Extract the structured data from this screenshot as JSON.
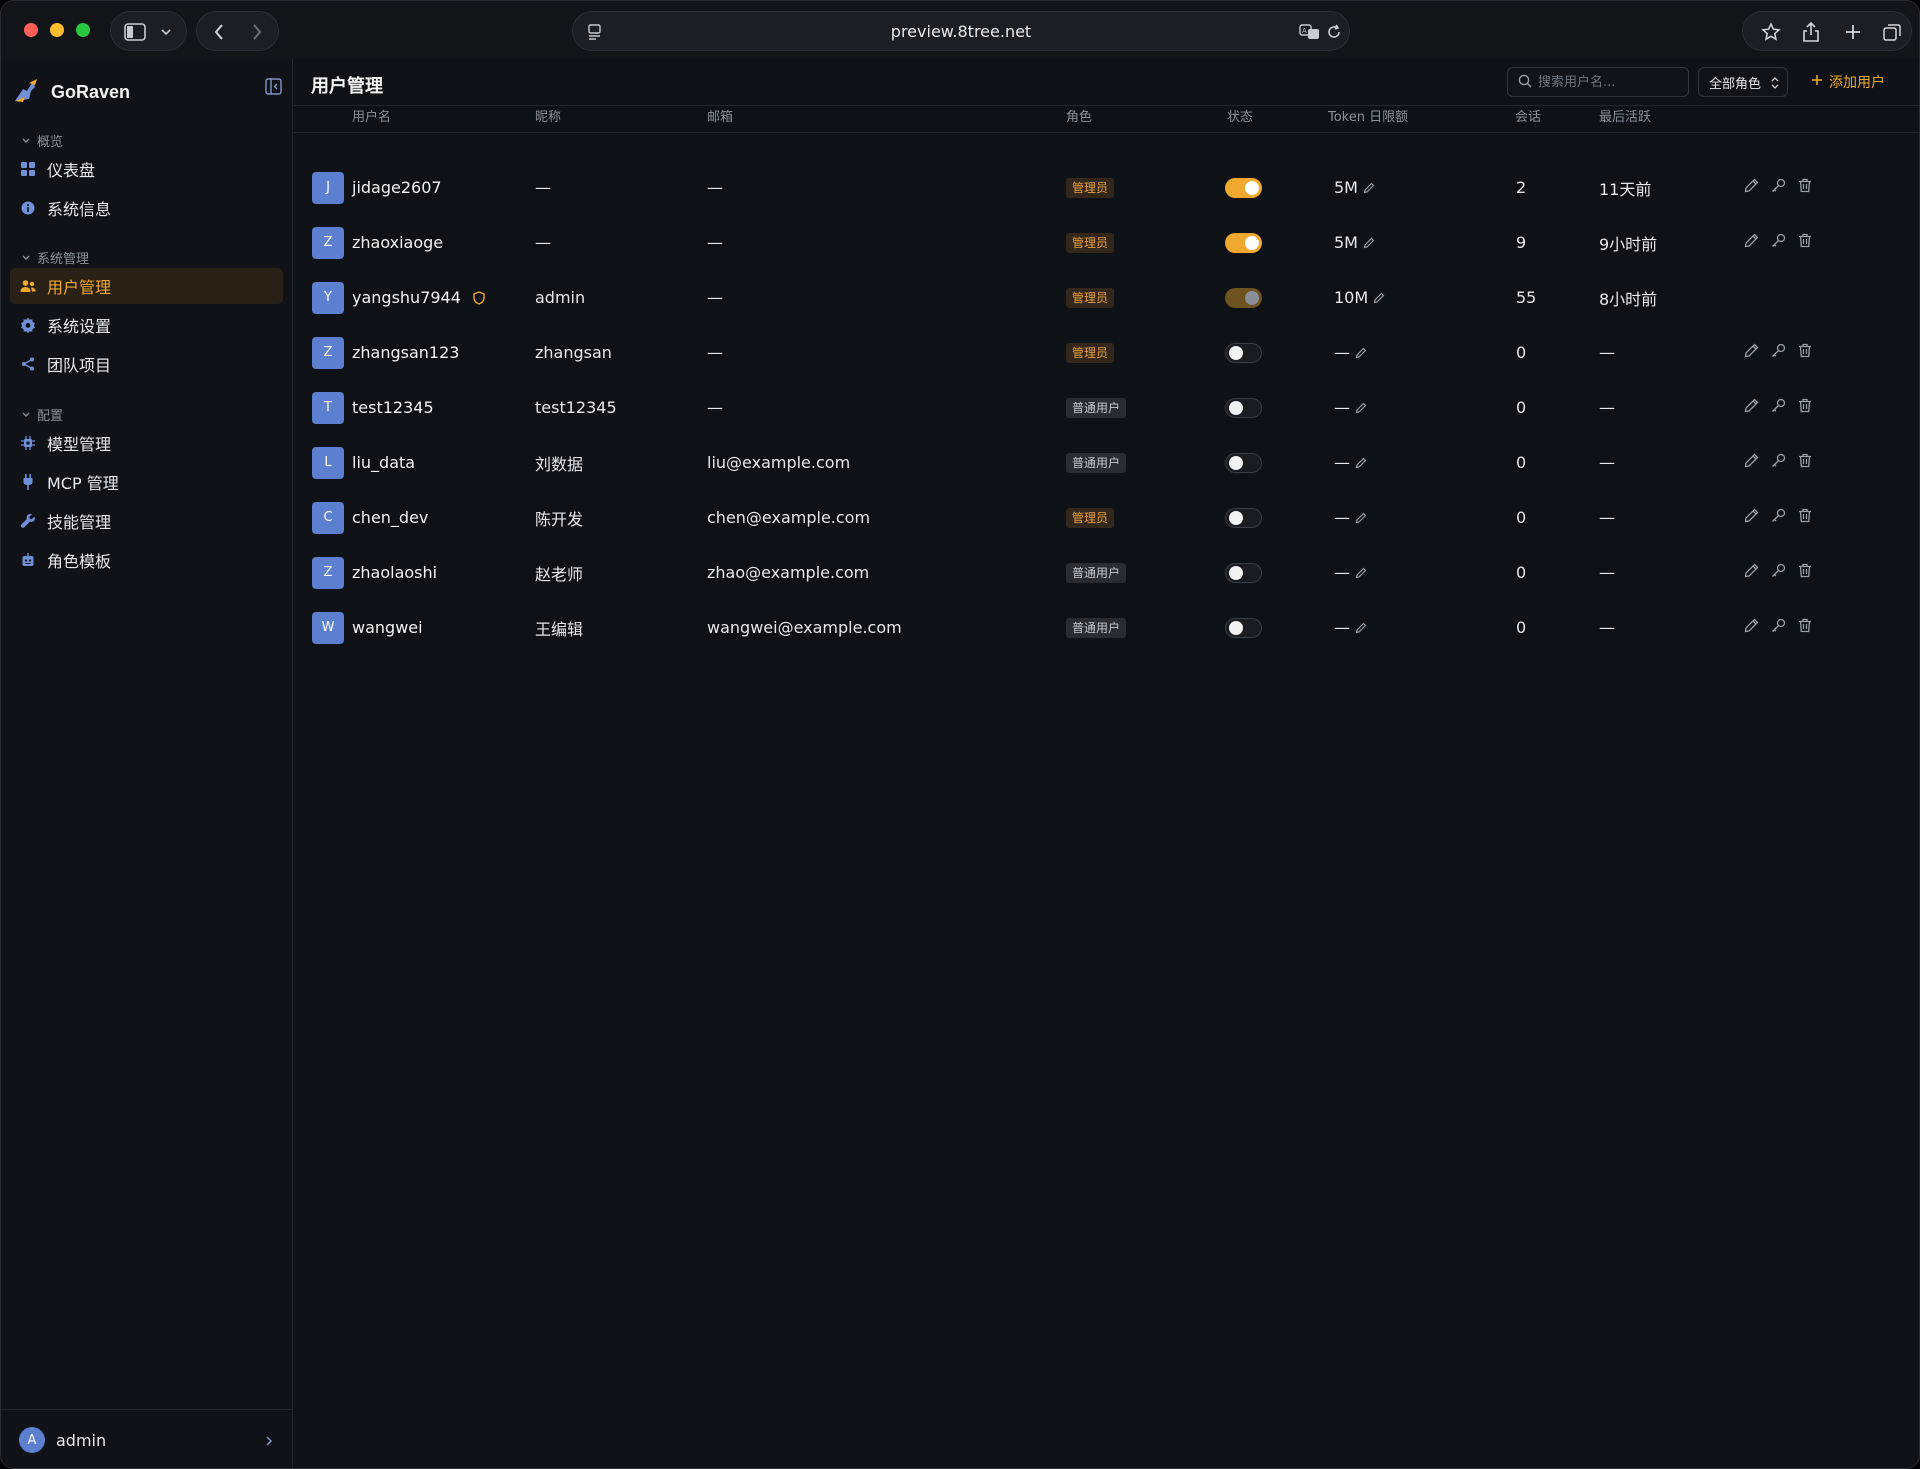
{
  "browser": {
    "url": "preview.8tree.net"
  },
  "sidebar": {
    "brand": "GoRaven",
    "sections": [
      {
        "title": "概览",
        "items": [
          {
            "label": "仪表盘",
            "icon": "grid-icon"
          },
          {
            "label": "系统信息",
            "icon": "info-icon"
          }
        ]
      },
      {
        "title": "系统管理",
        "items": [
          {
            "label": "用户管理",
            "icon": "users-icon",
            "active": true
          },
          {
            "label": "系统设置",
            "icon": "gear-icon"
          },
          {
            "label": "团队项目",
            "icon": "share-icon"
          }
        ]
      },
      {
        "title": "配置",
        "items": [
          {
            "label": "模型管理",
            "icon": "cpu-icon"
          },
          {
            "label": "MCP 管理",
            "icon": "plug-icon"
          },
          {
            "label": "技能管理",
            "icon": "wrench-icon"
          },
          {
            "label": "角色模板",
            "icon": "bot-icon"
          }
        ]
      }
    ],
    "user": {
      "avatar": "A",
      "name": "admin"
    }
  },
  "main": {
    "title": "用户管理",
    "search_placeholder": "搜索用户名...",
    "role_filter": "全部角色",
    "add_user": "添加用户",
    "columns": [
      "用户名",
      "昵称",
      "邮箱",
      "角色",
      "状态",
      "Token 日限额",
      "会话",
      "最后活跃"
    ],
    "rows": [
      {
        "avatar": "J",
        "username": "jidage2607",
        "nickname": "—",
        "email": "—",
        "role": "管理员",
        "role_type": "admin",
        "status": "on",
        "token_limit": "5M",
        "sessions": "2",
        "last_active": "11天前",
        "actions": true,
        "shield": false
      },
      {
        "avatar": "Z",
        "username": "zhaoxiaoge",
        "nickname": "—",
        "email": "—",
        "role": "管理员",
        "role_type": "admin",
        "status": "on",
        "token_limit": "5M",
        "sessions": "9",
        "last_active": "9小时前",
        "actions": true,
        "shield": false
      },
      {
        "avatar": "Y",
        "username": "yangshu7944",
        "nickname": "admin",
        "email": "—",
        "role": "管理员",
        "role_type": "admin",
        "status": "dim",
        "token_limit": "10M",
        "sessions": "55",
        "last_active": "8小时前",
        "actions": false,
        "shield": true
      },
      {
        "avatar": "Z",
        "username": "zhangsan123",
        "nickname": "zhangsan",
        "email": "—",
        "role": "管理员",
        "role_type": "admin",
        "status": "off",
        "token_limit": "—",
        "sessions": "0",
        "last_active": "—",
        "actions": true,
        "shield": false
      },
      {
        "avatar": "T",
        "username": "test12345",
        "nickname": "test12345",
        "email": "—",
        "role": "普通用户",
        "role_type": "user",
        "status": "off",
        "token_limit": "—",
        "sessions": "0",
        "last_active": "—",
        "actions": true,
        "shield": false
      },
      {
        "avatar": "L",
        "username": "liu_data",
        "nickname": "刘数据",
        "email": "liu@example.com",
        "role": "普通用户",
        "role_type": "user",
        "status": "off",
        "token_limit": "—",
        "sessions": "0",
        "last_active": "—",
        "actions": true,
        "shield": false
      },
      {
        "avatar": "C",
        "username": "chen_dev",
        "nickname": "陈开发",
        "email": "chen@example.com",
        "role": "管理员",
        "role_type": "admin",
        "status": "off",
        "token_limit": "—",
        "sessions": "0",
        "last_active": "—",
        "actions": true,
        "shield": false
      },
      {
        "avatar": "Z",
        "username": "zhaolaoshi",
        "nickname": "赵老师",
        "email": "zhao@example.com",
        "role": "普通用户",
        "role_type": "user",
        "status": "off",
        "token_limit": "—",
        "sessions": "0",
        "last_active": "—",
        "actions": true,
        "shield": false
      },
      {
        "avatar": "W",
        "username": "wangwei",
        "nickname": "王编辑",
        "email": "wangwei@example.com",
        "role": "普通用户",
        "role_type": "user",
        "status": "off",
        "token_limit": "—",
        "sessions": "0",
        "last_active": "—",
        "actions": true,
        "shield": false
      }
    ]
  },
  "colors": {
    "accent": "#f0a92e",
    "background": "#0e1116",
    "avatar": "#5c7fd0"
  }
}
